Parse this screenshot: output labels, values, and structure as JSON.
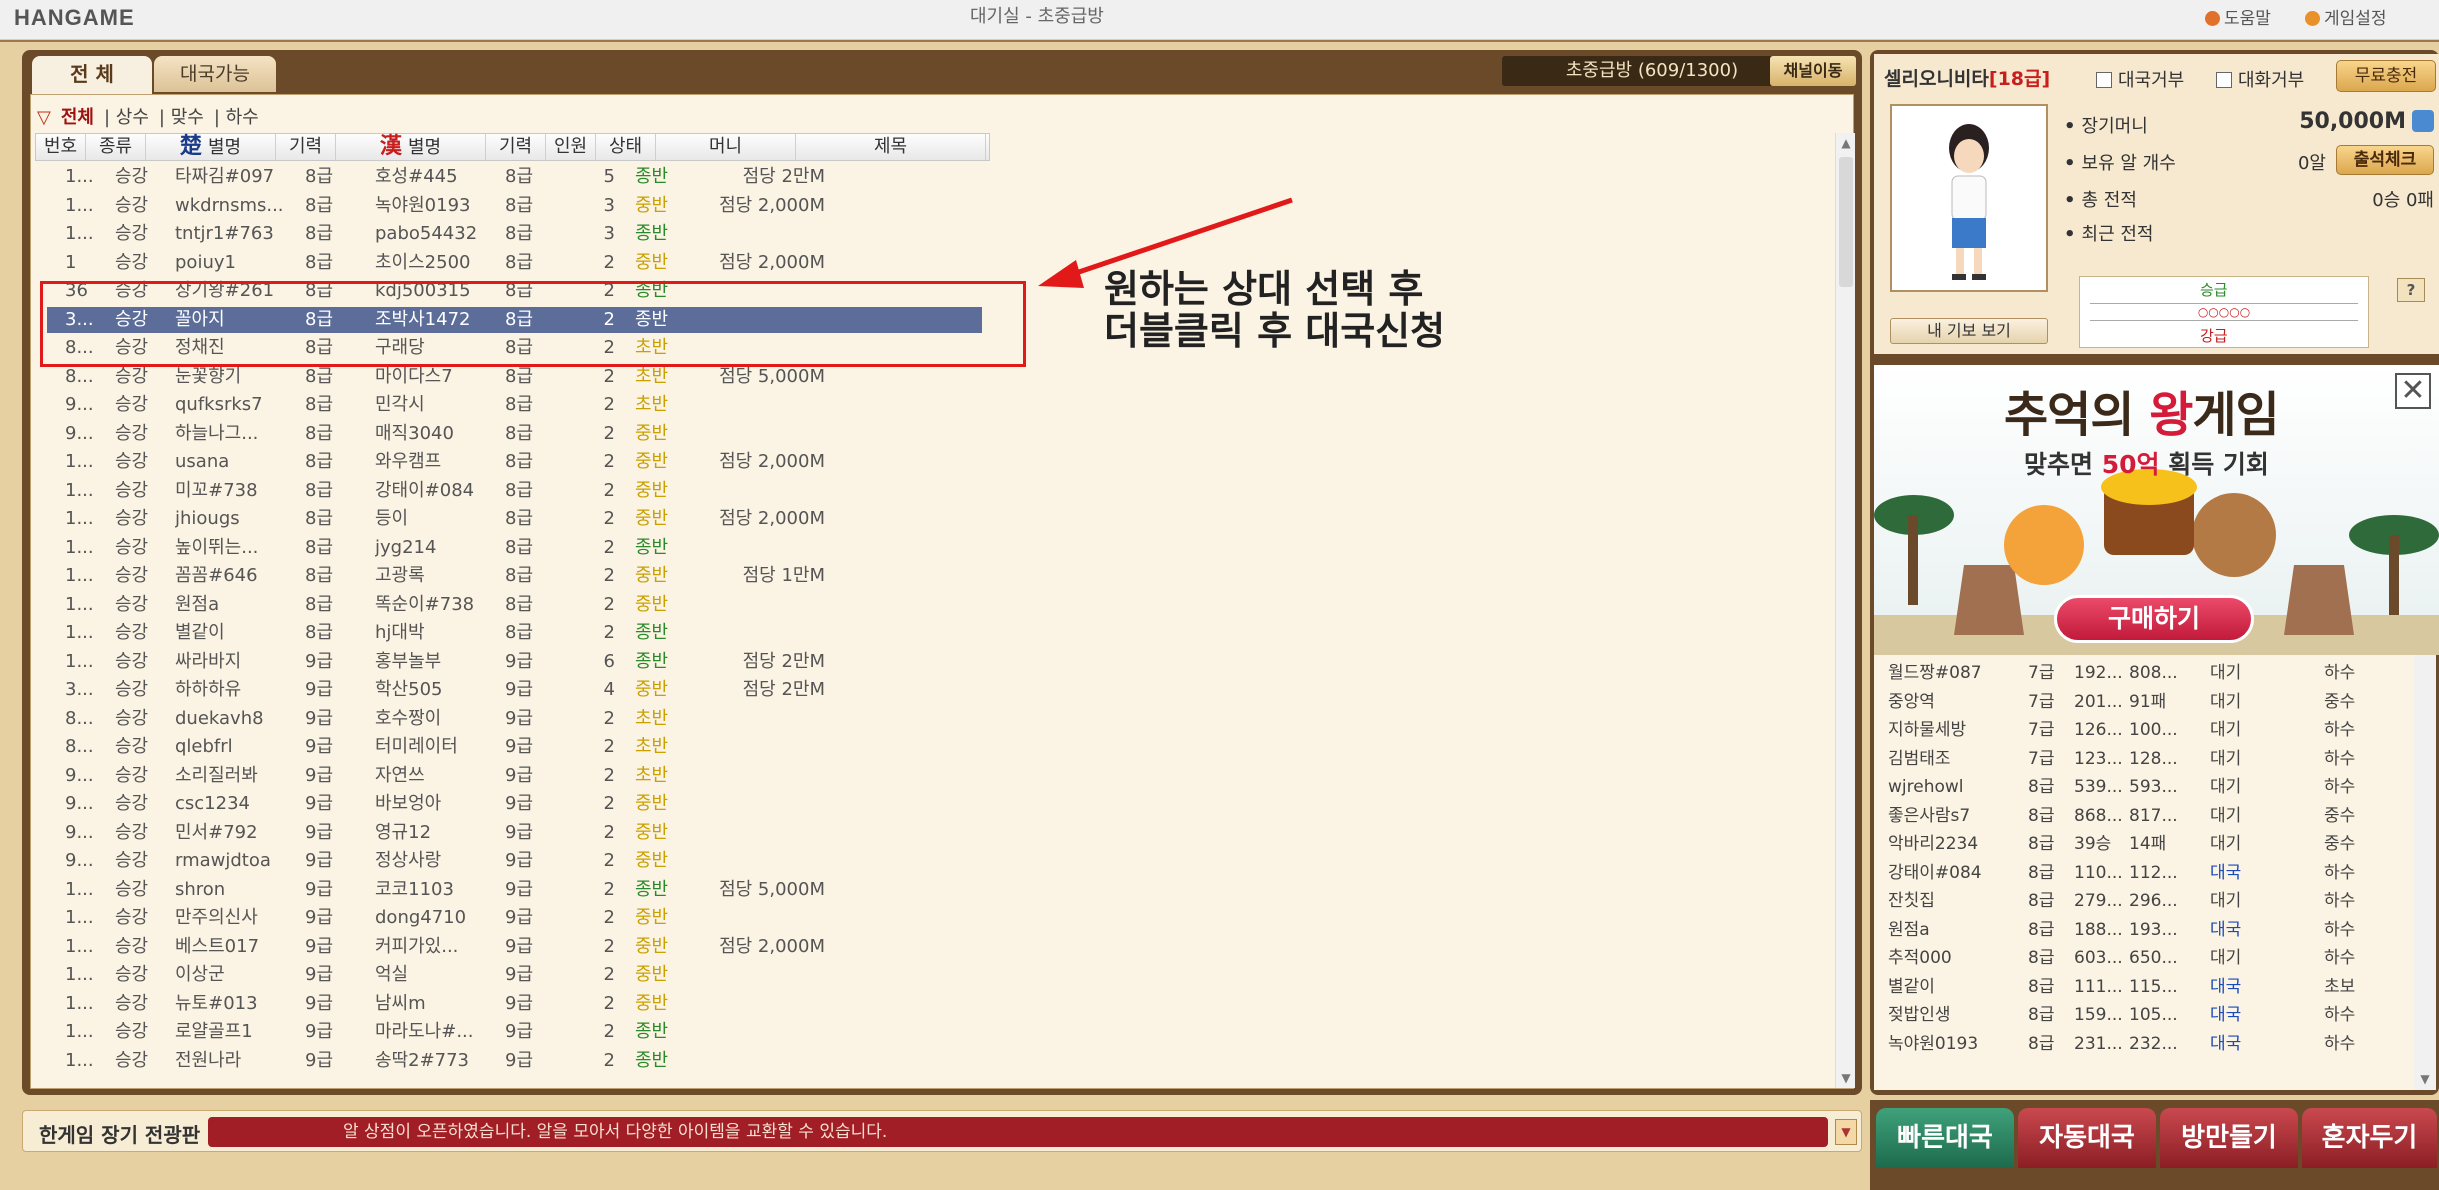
{
  "window": {
    "logo": "HANGAME",
    "title": "대기실 - 초중급방",
    "help": "도움말",
    "settings": "게임설정"
  },
  "tabs": {
    "all": "전 체",
    "available": "대국가능"
  },
  "channel": {
    "info": "초중급방 (609/1300)",
    "move": "채널이동"
  },
  "filters": [
    "전체",
    "상수",
    "맞수",
    "하수"
  ],
  "table": {
    "columns": {
      "no": "번호",
      "type": "종류",
      "chu_char": "楚",
      "chu": "별명",
      "chu_grade": "기력",
      "han_char": "漢",
      "han": "별명",
      "han_grade": "기력",
      "people": "인원",
      "status": "상태",
      "money": "머니",
      "subject": "제목"
    },
    "rows": [
      [
        "1...",
        "승강",
        "타짜김#097",
        "8급",
        "호성#445",
        "8급",
        "5",
        "종반",
        "점당 2만M"
      ],
      [
        "1...",
        "승강",
        "wkdrnsms...",
        "8급",
        "녹야원0193",
        "8급",
        "3",
        "중반",
        "점당 2,000M"
      ],
      [
        "1...",
        "승강",
        "tntjr1#763",
        "8급",
        "pabo54432",
        "8급",
        "3",
        "종반",
        ""
      ],
      [
        "1",
        "승강",
        "poiuy1",
        "8급",
        "초이스2500",
        "8급",
        "2",
        "중반",
        "점당 2,000M"
      ],
      [
        "36",
        "승강",
        "장기왕#261",
        "8급",
        "kdj500315",
        "8급",
        "2",
        "종반",
        ""
      ],
      [
        "3...",
        "승강",
        "꼴아지",
        "8급",
        "조박사1472",
        "8급",
        "2",
        "종반",
        ""
      ],
      [
        "8...",
        "승강",
        "정채진",
        "8급",
        "구래당",
        "8급",
        "2",
        "초반",
        ""
      ],
      [
        "8...",
        "승강",
        "눈꽃향기",
        "8급",
        "마이다스7",
        "8급",
        "2",
        "초반",
        "점당 5,000M"
      ],
      [
        "9...",
        "승강",
        "qufksrks7",
        "8급",
        "민각시",
        "8급",
        "2",
        "초반",
        ""
      ],
      [
        "9...",
        "승강",
        "하늘나그...",
        "8급",
        "매직3040",
        "8급",
        "2",
        "중반",
        ""
      ],
      [
        "1...",
        "승강",
        "usana",
        "8급",
        "와우캠프",
        "8급",
        "2",
        "중반",
        "점당 2,000M"
      ],
      [
        "1...",
        "승강",
        "미꼬#738",
        "8급",
        "강태이#084",
        "8급",
        "2",
        "중반",
        ""
      ],
      [
        "1...",
        "승강",
        "jhiougs",
        "8급",
        "등이",
        "8급",
        "2",
        "중반",
        "점당 2,000M"
      ],
      [
        "1...",
        "승강",
        "높이뛰는...",
        "8급",
        "jyg214",
        "8급",
        "2",
        "종반",
        ""
      ],
      [
        "1...",
        "승강",
        "꼼꼼#646",
        "8급",
        "고광록",
        "8급",
        "2",
        "중반",
        "점당 1만M"
      ],
      [
        "1...",
        "승강",
        "원점a",
        "8급",
        "똑순이#738",
        "8급",
        "2",
        "중반",
        ""
      ],
      [
        "1...",
        "승강",
        "별같이",
        "8급",
        "hj대박",
        "8급",
        "2",
        "종반",
        ""
      ],
      [
        "1...",
        "승강",
        "싸라바지",
        "9급",
        "홍부놀부",
        "9급",
        "6",
        "종반",
        "점당 2만M"
      ],
      [
        "3...",
        "승강",
        "하하하유",
        "9급",
        "학산505",
        "9급",
        "4",
        "중반",
        "점당 2만M"
      ],
      [
        "8...",
        "승강",
        "duekavh8",
        "9급",
        "호수짱이",
        "9급",
        "2",
        "초반",
        ""
      ],
      [
        "8...",
        "승강",
        "qlebfrl",
        "9급",
        "터미레이터",
        "9급",
        "2",
        "초반",
        ""
      ],
      [
        "9...",
        "승강",
        "소리질러봐",
        "9급",
        "자연쓰",
        "9급",
        "2",
        "초반",
        ""
      ],
      [
        "9...",
        "승강",
        "csc1234",
        "9급",
        "바보엉아",
        "9급",
        "2",
        "중반",
        ""
      ],
      [
        "9...",
        "승강",
        "민서#792",
        "9급",
        "영규12",
        "9급",
        "2",
        "중반",
        ""
      ],
      [
        "9...",
        "승강",
        "rmawjdtoa",
        "9급",
        "정상사랑",
        "9급",
        "2",
        "중반",
        ""
      ],
      [
        "1...",
        "승강",
        "shron",
        "9급",
        "코코1103",
        "9급",
        "2",
        "종반",
        "점당 5,000M"
      ],
      [
        "1...",
        "승강",
        "만주의신사",
        "9급",
        "dong4710",
        "9급",
        "2",
        "중반",
        ""
      ],
      [
        "1...",
        "승강",
        "베스트017",
        "9급",
        "커피가있...",
        "9급",
        "2",
        "중반",
        "점당 2,000M"
      ],
      [
        "1...",
        "승강",
        "이상군",
        "9급",
        "억실",
        "9급",
        "2",
        "중반",
        ""
      ],
      [
        "1...",
        "승강",
        "뉴토#013",
        "9급",
        "남씨m",
        "9급",
        "2",
        "중반",
        ""
      ],
      [
        "1...",
        "승강",
        "로얄골프1",
        "9급",
        "마라도나#...",
        "9급",
        "2",
        "종반",
        ""
      ],
      [
        "1...",
        "승강",
        "전원나라",
        "9급",
        "송딱2#773",
        "9급",
        "2",
        "종반",
        ""
      ]
    ],
    "selected_index": 5
  },
  "annotation": {
    "line1": "원하는 상대 선택 후",
    "line2": "더블클릭 후 대국신청"
  },
  "notice": {
    "board": "한게임 장기 전광판",
    "text": "알 상점이 오픈하였습니다. 알을 모아서 다양한 아이템을 교환할 수 있습니다."
  },
  "profile": {
    "name": "셀리오니비타",
    "grade": "[18급]",
    "refuse_game": "대국거부",
    "refuse_chat": "대화거부",
    "free_charge": "무료충전",
    "money_label": "장기머니",
    "money_value": "50,000M",
    "eggs_label": "보유 알 개수",
    "eggs_value": "0알",
    "attend": "출석체크",
    "record_label": "총 전적",
    "record_value": "0승 0패",
    "recent_label": "최근 전적",
    "promote": "승급",
    "demote": "강급",
    "view_records": "내 기보 보기",
    "q": "?"
  },
  "ad": {
    "title_a": "추억의 ",
    "title_b": "왕",
    "title_c": "게임",
    "sub_a": "맞추면 ",
    "sub_b": "50억",
    "sub_c": " 획득 기회",
    "buy": "구매하기",
    "close": "✕"
  },
  "users": [
    [
      "월드짱#087",
      "7급",
      "192...",
      "808...",
      "대기",
      "하수"
    ],
    [
      "중앙역",
      "7급",
      "201...",
      "91패",
      "대기",
      "중수"
    ],
    [
      "지하물세방",
      "7급",
      "126...",
      "100...",
      "대기",
      "하수"
    ],
    [
      "김범태조",
      "7급",
      "123...",
      "128...",
      "대기",
      "하수"
    ],
    [
      "wjrehowl",
      "8급",
      "539...",
      "593...",
      "대기",
      "하수"
    ],
    [
      "좋은사람s7",
      "8급",
      "868...",
      "817...",
      "대기",
      "중수"
    ],
    [
      "악바리2234",
      "8급",
      "39승",
      "14패",
      "대기",
      "중수"
    ],
    [
      "강태이#084",
      "8급",
      "110...",
      "112...",
      "대국",
      "하수"
    ],
    [
      "잔칫집",
      "8급",
      "279...",
      "296...",
      "대기",
      "하수"
    ],
    [
      "원점a",
      "8급",
      "188...",
      "193...",
      "대국",
      "하수"
    ],
    [
      "추적000",
      "8급",
      "603...",
      "650...",
      "대기",
      "하수"
    ],
    [
      "별같이",
      "8급",
      "111...",
      "115...",
      "대국",
      "초보"
    ],
    [
      "젖밥인생",
      "8급",
      "159...",
      "105...",
      "대국",
      "하수"
    ],
    [
      "녹야원0193",
      "8급",
      "231...",
      "232...",
      "대국",
      "하수"
    ]
  ],
  "actions": {
    "quick": "빠른대국",
    "auto": "자동대국",
    "room": "방만들기",
    "solo": "혼자두기"
  },
  "colors": {
    "selected": "#5c6d99",
    "annotation_red": "#e11919",
    "status_green": "#2a8a2a",
    "status_yellow": "#c9a000"
  }
}
